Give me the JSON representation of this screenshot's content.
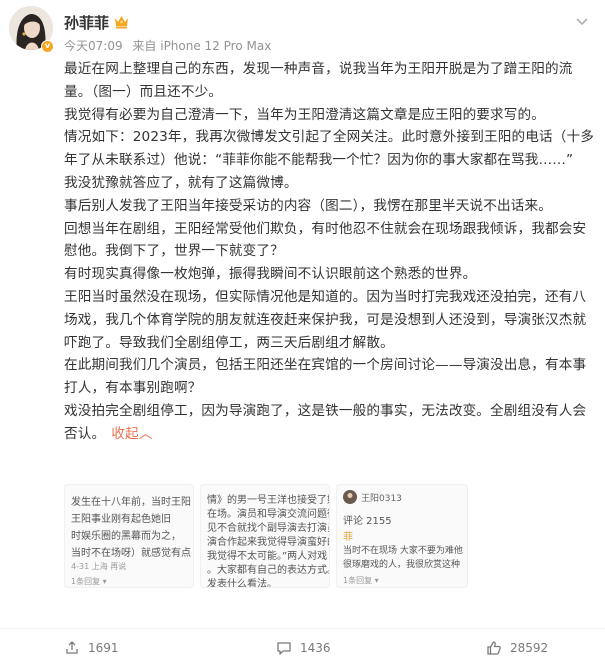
{
  "post": {
    "username": "孙菲菲",
    "time": "今天07:09",
    "source": "来自 iPhone 12 Pro Max",
    "paragraphs": [
      "最近在网上整理自己的东西，发现一种声音，说我当年为王阳开脱是为了蹭王阳的流量。（图一）而且还不少。",
      "我觉得有必要为自己澄清一下，当年为王阳澄清这篇文章是应王阳的要求写的。",
      "情况如下：2023年，我再次微博发文引起了全网关注。此时意外接到王阳的电话（十多年了从未联系过）他说：“菲菲你能不能帮我一个忙？因为你的事大家都在骂我……”",
      "我没犹豫就答应了，就有了这篇微博。",
      "事后别人发我了王阳当年接受采访的内容（图二），我愣在那里半天说不出话来。",
      "回想当年在剧组，王阳经常受他们欺负，有时他忍不住就会在现场跟我倾诉，我都会安慰他。我倒下了，世界一下就变了？",
      "有时现实真得像一枚炮弹，振得我瞬间不认识眼前这个熟悉的世界。",
      "王阳当时虽然没在现场，但实际情况他是知道的。因为当时打完我戏还没拍完，还有八场戏，我几个体育学院的朋友就连夜赶来保护我，可是没想到人还没到，导演张汉杰就吓跑了。导致我们全剧组停工，两三天后剧组才解散。",
      "在此期间我们几个演员，包括王阳还坐在宾馆的一个房间讨论——导演没出息，有本事打人，有本事别跑啊？",
      "戏没拍完全剧组停工，因为导演跑了，这是铁一般的事实，无法改变。全剧组没有人会否认。"
    ],
    "collapse_label": "收起",
    "collapse_arrow": "︿"
  },
  "thumbnails": [
    {
      "lines": [
        "发生在十八年前，当时王阳",
        "王阳事业刚有起色她旧",
        "时娱乐圈的黑幕而为之，",
        "当时不在场呀）就感觉有点",
        "4-31 上海  再说",
        "1条回复 ▾"
      ]
    },
    {
      "lines": [
        "情》的男一号王洋也接受了媒",
        "在场。演员和导演交流问题很",
        "见不合就找个副导演去打演员",
        "演合作起来我觉得导演蛮好的",
        "我觉得不太可能。”两人对戏",
        "。大家都有自己的表达方式。",
        "发表什么看法。"
      ]
    },
    {
      "name": "王阳0313",
      "lines": [
        "评论 2155",
        "菲",
        "当时不在现场 大家不要为难他",
        "很琢磨戏的人，我很欣赏这种",
        "1条回复 ▾"
      ]
    }
  ],
  "actions": {
    "share_count": "1691",
    "comment_count": "1436",
    "like_count": "28592"
  },
  "colors": {
    "accent": "#eb7350",
    "meta_gray": "#939393",
    "crown_gold": "#f6a623"
  }
}
